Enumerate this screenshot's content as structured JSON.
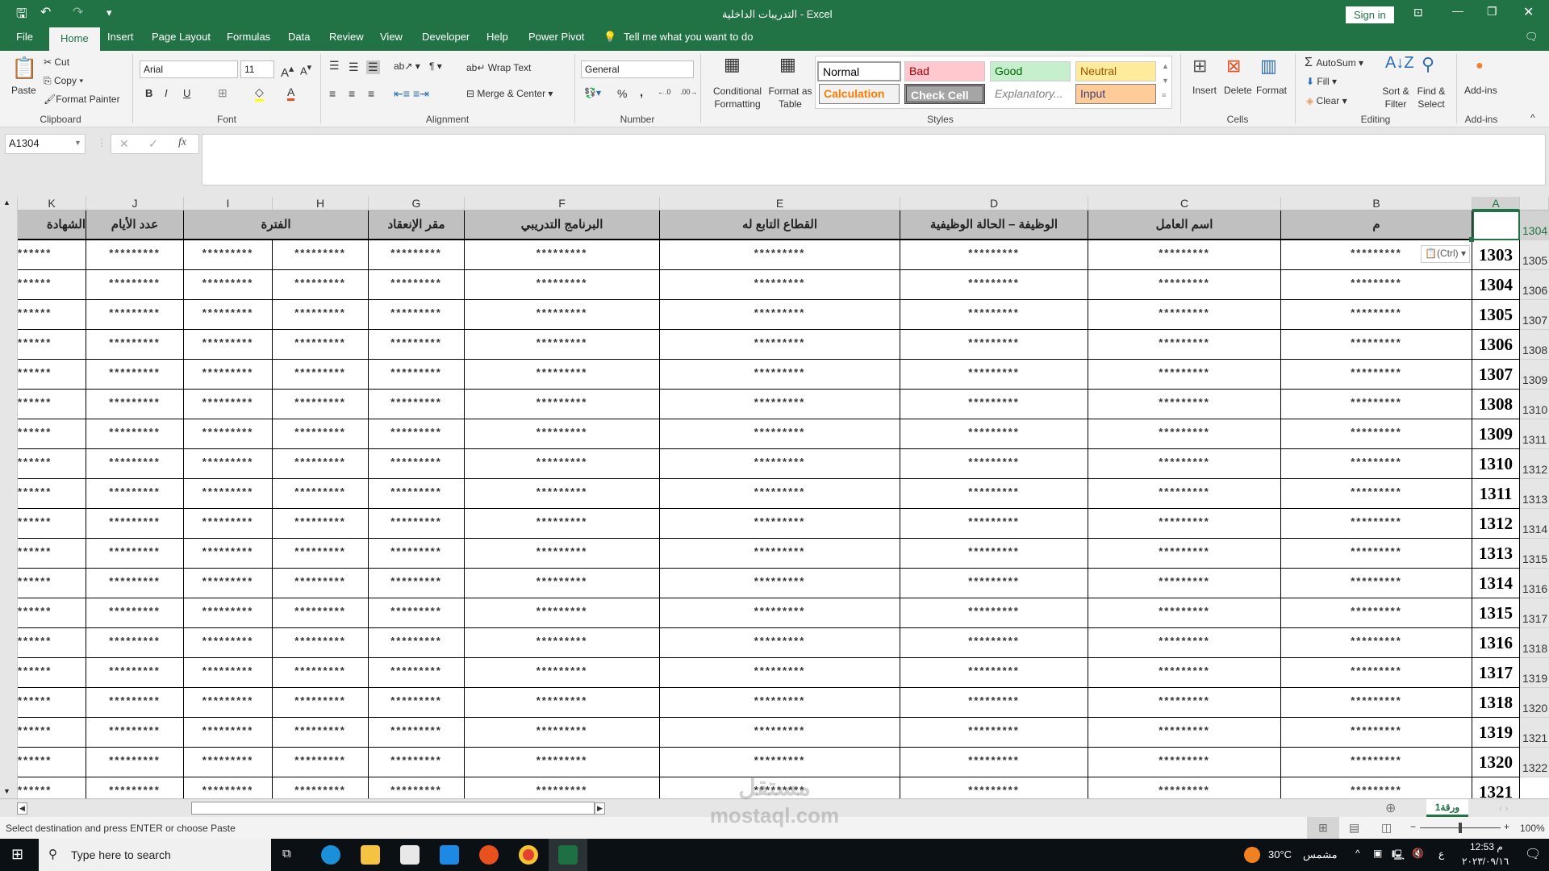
{
  "window": {
    "title": "التدريبات الداخلية  -  Excel",
    "sign_in": "Sign in"
  },
  "qat": {
    "save": "save-icon",
    "undo": "undo-icon",
    "redo": "redo-icon"
  },
  "tabs": [
    "File",
    "Home",
    "Insert",
    "Page Layout",
    "Formulas",
    "Data",
    "Review",
    "View",
    "Developer",
    "Help",
    "Power Pivot"
  ],
  "tell_me": "Tell me what you want to do",
  "ribbon": {
    "clipboard": {
      "paste": "Paste",
      "cut": "Cut",
      "copy": "Copy",
      "format_painter": "Format Painter",
      "label": "Clipboard"
    },
    "font": {
      "name": "Arial",
      "size": "11",
      "bold": "B",
      "italic": "I",
      "underline": "U",
      "label": "Font"
    },
    "alignment": {
      "wrap": "Wrap Text",
      "merge": "Merge & Center",
      "label": "Alignment"
    },
    "number": {
      "format": "General",
      "percent": "%",
      "comma": ",",
      "label": "Number"
    },
    "styles": {
      "conditional": "Conditional Formatting",
      "format_table": "Format as Table",
      "label": "Styles",
      "items": [
        {
          "name": "Normal",
          "bg": "#ffffff",
          "fg": "#000000"
        },
        {
          "name": "Bad",
          "bg": "#ffc7ce",
          "fg": "#9c0006"
        },
        {
          "name": "Good",
          "bg": "#c6efce",
          "fg": "#006100"
        },
        {
          "name": "Neutral",
          "bg": "#ffeb9c",
          "fg": "#9c5700"
        },
        {
          "name": "Calculation",
          "bg": "#f2f2f2",
          "fg": "#fa7d00"
        },
        {
          "name": "Check Cell",
          "bg": "#a5a5a5",
          "fg": "#ffffff"
        },
        {
          "name": "Explanatory...",
          "bg": "#ffffff",
          "fg": "#7f7f7f"
        },
        {
          "name": "Input",
          "bg": "#ffcc99",
          "fg": "#3f3f76"
        }
      ]
    },
    "cells": {
      "insert": "Insert",
      "delete": "Delete",
      "format": "Format",
      "label": "Cells"
    },
    "editing": {
      "autosum": "AutoSum",
      "fill": "Fill",
      "clear": "Clear",
      "sort": "Sort & Filter",
      "find": "Find & Select",
      "label": "Editing"
    },
    "addins": {
      "addins": "Add-ins",
      "label": "Add-ins"
    }
  },
  "formula_bar": {
    "name_box": "A1304",
    "fx": "fx",
    "value": ""
  },
  "sheet": {
    "columns": [
      "K",
      "J",
      "I",
      "H",
      "G",
      "F",
      "E",
      "D",
      "C",
      "B",
      "A"
    ],
    "headers": [
      "الشهادة",
      "عدد الأيام",
      "الفترة",
      "مقر الإنعقاد",
      "البرنامج التدريبي",
      "القطاع التابع له",
      "الوظيفة – الحالة الوظيفية",
      "اسم العامل",
      "م",
      ""
    ],
    "selected_cell": "A1304",
    "paste_options": "(Ctrl)",
    "row_numbers": [
      "1304",
      "1305",
      "1306",
      "1307",
      "1308",
      "1309",
      "1310",
      "1311",
      "1312",
      "1313",
      "1314",
      "1315",
      "1316",
      "1317",
      "1318",
      "1319",
      "1320",
      "1321",
      "1322"
    ],
    "masked_value": "*********",
    "masked_value_k": "******",
    "serials": [
      "1303",
      "1304",
      "1305",
      "1306",
      "1307",
      "1308",
      "1309",
      "1310",
      "1311",
      "1312",
      "1313",
      "1314",
      "1315",
      "1316",
      "1317",
      "1318",
      "1319",
      "1320",
      "1321"
    ]
  },
  "sheet_tab": "ورقة1",
  "status": {
    "message": "Select destination and press ENTER or choose Paste",
    "zoom": "100%"
  },
  "taskbar": {
    "search": "Type here to search",
    "weather": "30°C",
    "weather_desc": "مشمس",
    "lang": "ع",
    "time": "12:53 م",
    "date": "٢٠٢٣/٠٩/١٦"
  },
  "watermark": "مستقل mostaql.com",
  "colors": {
    "excel_green": "#217346",
    "header_fill": "#c0c0c0"
  }
}
